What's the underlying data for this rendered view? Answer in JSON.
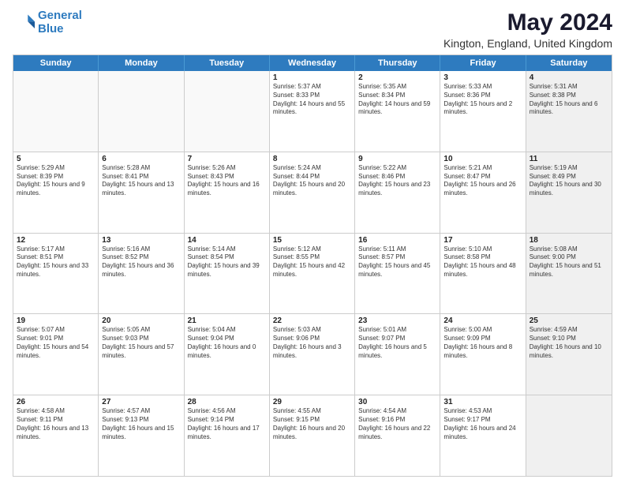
{
  "logo": {
    "line1": "General",
    "line2": "Blue"
  },
  "title": "May 2024",
  "subtitle": "Kington, England, United Kingdom",
  "days_of_week": [
    "Sunday",
    "Monday",
    "Tuesday",
    "Wednesday",
    "Thursday",
    "Friday",
    "Saturday"
  ],
  "weeks": [
    [
      {
        "day": "",
        "sunrise": "",
        "sunset": "",
        "daylight": "",
        "shaded": false
      },
      {
        "day": "",
        "sunrise": "",
        "sunset": "",
        "daylight": "",
        "shaded": false
      },
      {
        "day": "",
        "sunrise": "",
        "sunset": "",
        "daylight": "",
        "shaded": false
      },
      {
        "day": "1",
        "sunrise": "Sunrise: 5:37 AM",
        "sunset": "Sunset: 8:33 PM",
        "daylight": "Daylight: 14 hours and 55 minutes.",
        "shaded": false
      },
      {
        "day": "2",
        "sunrise": "Sunrise: 5:35 AM",
        "sunset": "Sunset: 8:34 PM",
        "daylight": "Daylight: 14 hours and 59 minutes.",
        "shaded": false
      },
      {
        "day": "3",
        "sunrise": "Sunrise: 5:33 AM",
        "sunset": "Sunset: 8:36 PM",
        "daylight": "Daylight: 15 hours and 2 minutes.",
        "shaded": false
      },
      {
        "day": "4",
        "sunrise": "Sunrise: 5:31 AM",
        "sunset": "Sunset: 8:38 PM",
        "daylight": "Daylight: 15 hours and 6 minutes.",
        "shaded": true
      }
    ],
    [
      {
        "day": "5",
        "sunrise": "Sunrise: 5:29 AM",
        "sunset": "Sunset: 8:39 PM",
        "daylight": "Daylight: 15 hours and 9 minutes.",
        "shaded": false
      },
      {
        "day": "6",
        "sunrise": "Sunrise: 5:28 AM",
        "sunset": "Sunset: 8:41 PM",
        "daylight": "Daylight: 15 hours and 13 minutes.",
        "shaded": false
      },
      {
        "day": "7",
        "sunrise": "Sunrise: 5:26 AM",
        "sunset": "Sunset: 8:43 PM",
        "daylight": "Daylight: 15 hours and 16 minutes.",
        "shaded": false
      },
      {
        "day": "8",
        "sunrise": "Sunrise: 5:24 AM",
        "sunset": "Sunset: 8:44 PM",
        "daylight": "Daylight: 15 hours and 20 minutes.",
        "shaded": false
      },
      {
        "day": "9",
        "sunrise": "Sunrise: 5:22 AM",
        "sunset": "Sunset: 8:46 PM",
        "daylight": "Daylight: 15 hours and 23 minutes.",
        "shaded": false
      },
      {
        "day": "10",
        "sunrise": "Sunrise: 5:21 AM",
        "sunset": "Sunset: 8:47 PM",
        "daylight": "Daylight: 15 hours and 26 minutes.",
        "shaded": false
      },
      {
        "day": "11",
        "sunrise": "Sunrise: 5:19 AM",
        "sunset": "Sunset: 8:49 PM",
        "daylight": "Daylight: 15 hours and 30 minutes.",
        "shaded": true
      }
    ],
    [
      {
        "day": "12",
        "sunrise": "Sunrise: 5:17 AM",
        "sunset": "Sunset: 8:51 PM",
        "daylight": "Daylight: 15 hours and 33 minutes.",
        "shaded": false
      },
      {
        "day": "13",
        "sunrise": "Sunrise: 5:16 AM",
        "sunset": "Sunset: 8:52 PM",
        "daylight": "Daylight: 15 hours and 36 minutes.",
        "shaded": false
      },
      {
        "day": "14",
        "sunrise": "Sunrise: 5:14 AM",
        "sunset": "Sunset: 8:54 PM",
        "daylight": "Daylight: 15 hours and 39 minutes.",
        "shaded": false
      },
      {
        "day": "15",
        "sunrise": "Sunrise: 5:12 AM",
        "sunset": "Sunset: 8:55 PM",
        "daylight": "Daylight: 15 hours and 42 minutes.",
        "shaded": false
      },
      {
        "day": "16",
        "sunrise": "Sunrise: 5:11 AM",
        "sunset": "Sunset: 8:57 PM",
        "daylight": "Daylight: 15 hours and 45 minutes.",
        "shaded": false
      },
      {
        "day": "17",
        "sunrise": "Sunrise: 5:10 AM",
        "sunset": "Sunset: 8:58 PM",
        "daylight": "Daylight: 15 hours and 48 minutes.",
        "shaded": false
      },
      {
        "day": "18",
        "sunrise": "Sunrise: 5:08 AM",
        "sunset": "Sunset: 9:00 PM",
        "daylight": "Daylight: 15 hours and 51 minutes.",
        "shaded": true
      }
    ],
    [
      {
        "day": "19",
        "sunrise": "Sunrise: 5:07 AM",
        "sunset": "Sunset: 9:01 PM",
        "daylight": "Daylight: 15 hours and 54 minutes.",
        "shaded": false
      },
      {
        "day": "20",
        "sunrise": "Sunrise: 5:05 AM",
        "sunset": "Sunset: 9:03 PM",
        "daylight": "Daylight: 15 hours and 57 minutes.",
        "shaded": false
      },
      {
        "day": "21",
        "sunrise": "Sunrise: 5:04 AM",
        "sunset": "Sunset: 9:04 PM",
        "daylight": "Daylight: 16 hours and 0 minutes.",
        "shaded": false
      },
      {
        "day": "22",
        "sunrise": "Sunrise: 5:03 AM",
        "sunset": "Sunset: 9:06 PM",
        "daylight": "Daylight: 16 hours and 3 minutes.",
        "shaded": false
      },
      {
        "day": "23",
        "sunrise": "Sunrise: 5:01 AM",
        "sunset": "Sunset: 9:07 PM",
        "daylight": "Daylight: 16 hours and 5 minutes.",
        "shaded": false
      },
      {
        "day": "24",
        "sunrise": "Sunrise: 5:00 AM",
        "sunset": "Sunset: 9:09 PM",
        "daylight": "Daylight: 16 hours and 8 minutes.",
        "shaded": false
      },
      {
        "day": "25",
        "sunrise": "Sunrise: 4:59 AM",
        "sunset": "Sunset: 9:10 PM",
        "daylight": "Daylight: 16 hours and 10 minutes.",
        "shaded": true
      }
    ],
    [
      {
        "day": "26",
        "sunrise": "Sunrise: 4:58 AM",
        "sunset": "Sunset: 9:11 PM",
        "daylight": "Daylight: 16 hours and 13 minutes.",
        "shaded": false
      },
      {
        "day": "27",
        "sunrise": "Sunrise: 4:57 AM",
        "sunset": "Sunset: 9:13 PM",
        "daylight": "Daylight: 16 hours and 15 minutes.",
        "shaded": false
      },
      {
        "day": "28",
        "sunrise": "Sunrise: 4:56 AM",
        "sunset": "Sunset: 9:14 PM",
        "daylight": "Daylight: 16 hours and 17 minutes.",
        "shaded": false
      },
      {
        "day": "29",
        "sunrise": "Sunrise: 4:55 AM",
        "sunset": "Sunset: 9:15 PM",
        "daylight": "Daylight: 16 hours and 20 minutes.",
        "shaded": false
      },
      {
        "day": "30",
        "sunrise": "Sunrise: 4:54 AM",
        "sunset": "Sunset: 9:16 PM",
        "daylight": "Daylight: 16 hours and 22 minutes.",
        "shaded": false
      },
      {
        "day": "31",
        "sunrise": "Sunrise: 4:53 AM",
        "sunset": "Sunset: 9:17 PM",
        "daylight": "Daylight: 16 hours and 24 minutes.",
        "shaded": false
      },
      {
        "day": "",
        "sunrise": "",
        "sunset": "",
        "daylight": "",
        "shaded": true
      }
    ]
  ]
}
